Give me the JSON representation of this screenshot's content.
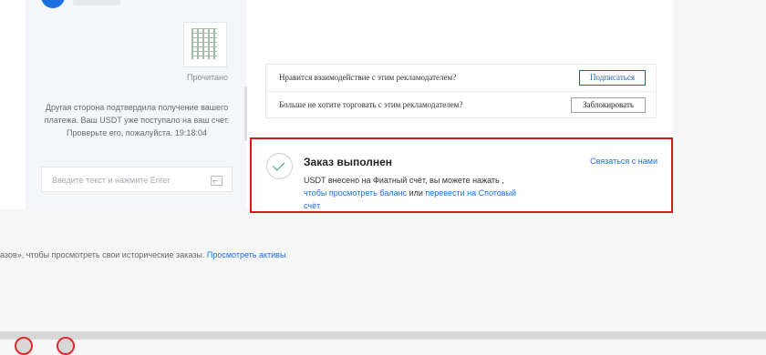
{
  "chat": {
    "read_status": "Прочитано",
    "system_message": "Другая сторона подтвердила получение вашего платежа. Ваш USDT уже поступало на ваш счет. Проверьте его, пожалуйста. 19:18:04",
    "input_placeholder": "Введите текст и нажмите Enter",
    "image_icon": "image-icon"
  },
  "advertiser": {
    "like_question": "Нравится взаимодействие с этим рекламодателем?",
    "subscribe_label": "Подписаться",
    "stop_question": "Больше не хотите торговать с этим рекламодателем?",
    "block_label": "Заблокировать"
  },
  "order": {
    "status_icon": "check-icon",
    "title": "Заказ выполнен",
    "contact_label": "Связаться с нами",
    "desc_prefix": "USDT внесено на Фиатный счёт, вы можете нажать ,",
    "view_balance_link": "чтобы просмотреть баланс",
    "or_text": "или",
    "transfer_link": "перевести на Спотовый счёт"
  },
  "history": {
    "text": "азов», чтобы просмотреть свои исторические заказы.",
    "view_assets_link": "Просмотреть активы"
  },
  "colors": {
    "accent": "#1b6fe0",
    "highlight_border": "#d6191f",
    "success": "#3da07a"
  }
}
